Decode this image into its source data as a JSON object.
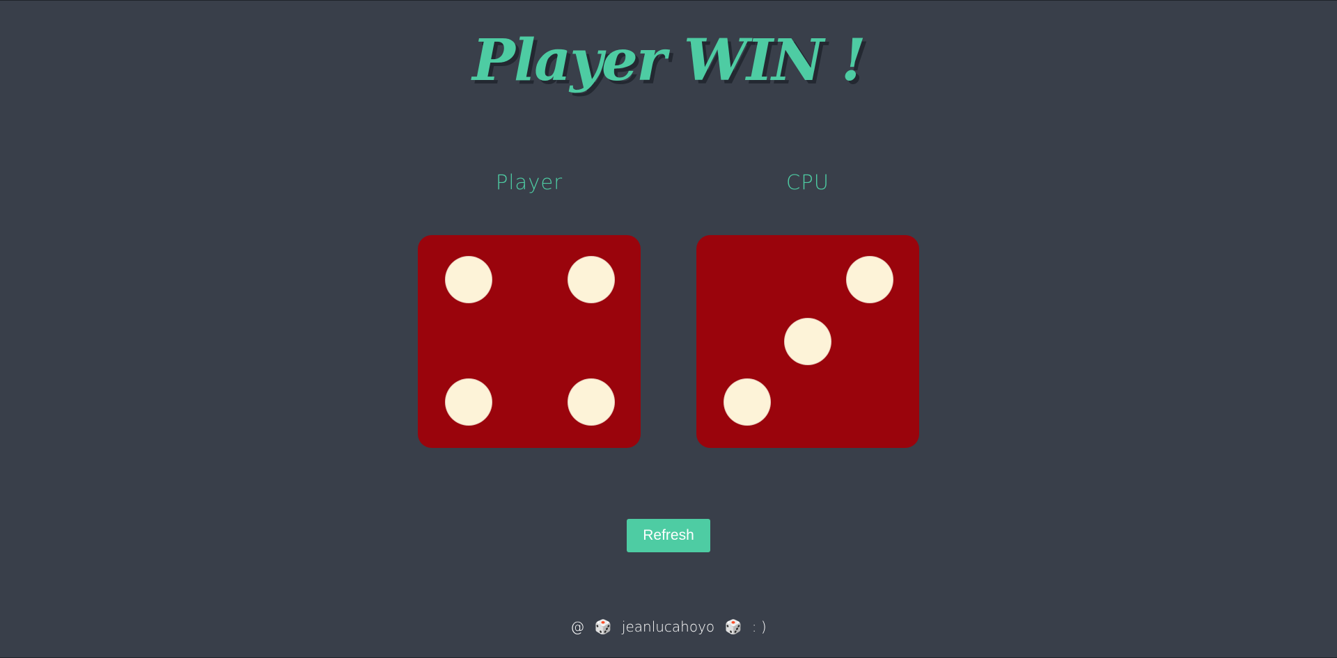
{
  "header": {
    "title": "Player WIN !"
  },
  "players": [
    {
      "label": "Player",
      "die_value": 4
    },
    {
      "label": "CPU",
      "die_value": 3
    }
  ],
  "actions": {
    "refresh_label": "Refresh"
  },
  "footer": {
    "prefix": "@",
    "dice_icon": "🎲",
    "author": "jeanlucahoyo",
    "smiley": ": )"
  },
  "colors": {
    "background": "#393f4a",
    "accent": "#4ecca3",
    "die": "#9a040c",
    "pip": "#fdf3d8"
  }
}
